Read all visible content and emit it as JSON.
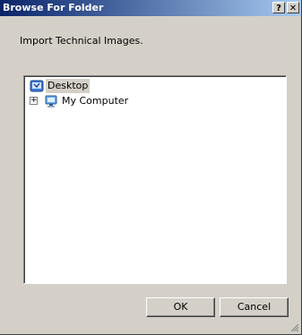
{
  "window": {
    "title": "Browse For Folder",
    "help_label": "?",
    "close_label": "✕"
  },
  "description": "Import Technical Images.",
  "tree": {
    "items": [
      {
        "label": "Desktop",
        "icon": "desktop-icon",
        "selected": true
      },
      {
        "label": "My Computer",
        "icon": "my-computer-icon",
        "expander": "+"
      }
    ]
  },
  "buttons": {
    "ok_label": "OK",
    "cancel_label": "Cancel"
  },
  "colors": {
    "title_start": "#0a246a",
    "title_end": "#a6caf0",
    "face": "#d4d0c8"
  }
}
